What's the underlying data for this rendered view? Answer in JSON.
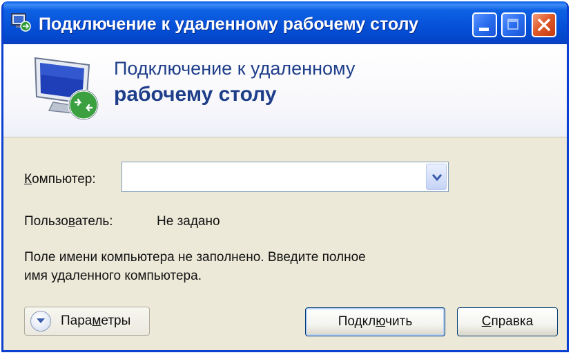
{
  "window": {
    "title": "Подключение к удаленному рабочему столу"
  },
  "banner": {
    "line1": "Подключение к удаленному",
    "line2": "рабочему столу"
  },
  "form": {
    "computer_label_accel": "К",
    "computer_label_rest": "омпьютер:",
    "computer_value": "",
    "user_label_pre": "Пользо",
    "user_label_accel": "в",
    "user_label_post": "атель:",
    "user_value": "Не задано",
    "hint_line1": "Поле имени компьютера не заполнено. Введите полное",
    "hint_line2": "имя удаленного компьютера."
  },
  "buttons": {
    "params_pre": "Пара",
    "params_accel": "м",
    "params_post": "етры",
    "connect_pre": "Подкл",
    "connect_accel": "ю",
    "connect_post": "чить",
    "help_accel": "С",
    "help_rest": "правка"
  },
  "icons": {
    "title_icon": "remote-desktop-icon",
    "banner_icon": "monitor-connection-icon",
    "combo_arrow": "chevron-down-icon",
    "params_arrow": "chevron-down-icon",
    "minimize": "minimize-icon",
    "maximize": "maximize-icon",
    "close": "close-icon"
  },
  "colors": {
    "titlebar": "#0652d9",
    "banner_text": "#1f3e8a",
    "dialog_bg": "#ece9d8",
    "close_button": "#e05a2a"
  }
}
